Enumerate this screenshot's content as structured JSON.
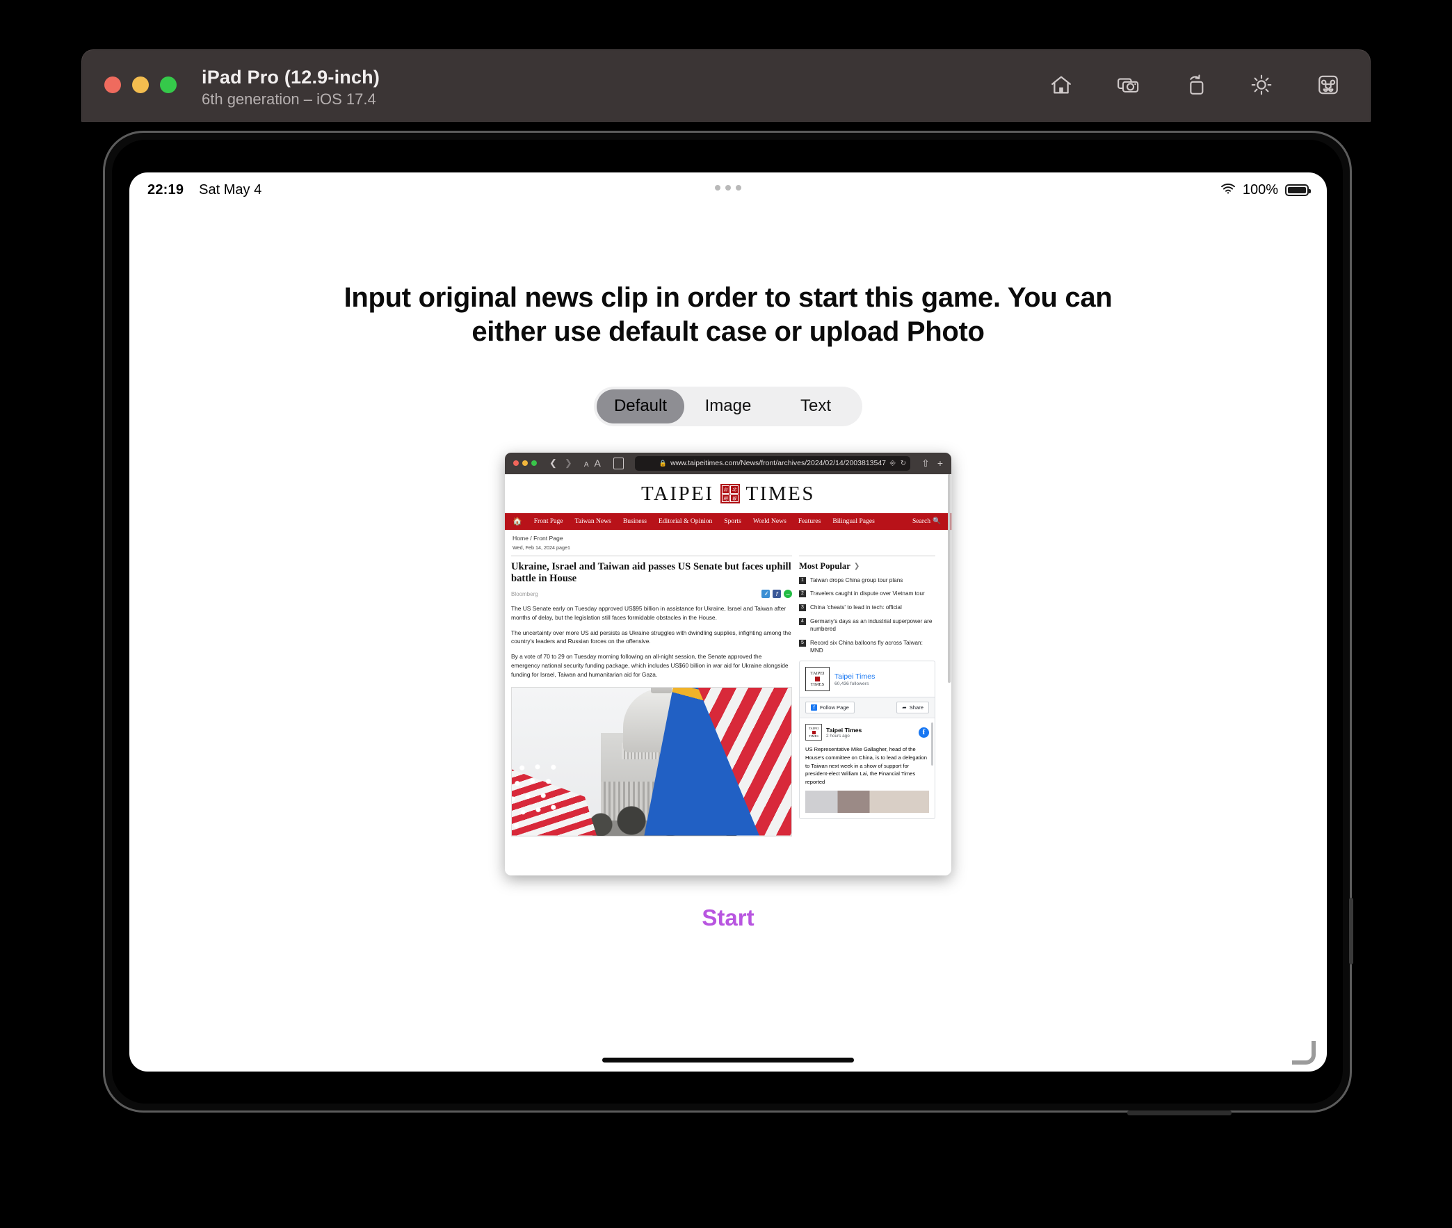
{
  "simulator": {
    "title": "iPad Pro (12.9-inch)",
    "subtitle": "6th generation – iOS 17.4",
    "toolbar": [
      {
        "name": "home-icon",
        "label": "Home"
      },
      {
        "name": "screenshot-icon",
        "label": "Screenshot"
      },
      {
        "name": "rotate-icon",
        "label": "Rotate"
      },
      {
        "name": "brightness-icon",
        "label": "Brightness"
      },
      {
        "name": "keyboard-icon",
        "label": "Keyboard"
      }
    ]
  },
  "statusbar": {
    "time": "22:19",
    "date": "Sat May 4",
    "battery_percent": "100%",
    "wifi_icon": "wifi-icon",
    "battery_icon": "battery-icon"
  },
  "app": {
    "headline": "Input original news clip in order to start this game. You can either use default case or upload Photo",
    "segmented": {
      "options": [
        "Default",
        "Image",
        "Text"
      ],
      "selected": "Default"
    },
    "start_label": "Start",
    "start_color": "#b855e0"
  },
  "screenshot": {
    "browser": {
      "url": "www.taipeitimes.com/News/front/archives/2024/02/14/2003813547",
      "lock_icon": "lock-icon",
      "back_icon": "chevron-left-icon",
      "forward_icon": "chevron-right-icon",
      "text_size_small": "A",
      "text_size_large": "A",
      "reader_icon": "reader-view-icon",
      "extension_icon": "extension-icon",
      "reload_icon": "reload-icon",
      "share_icon": "share-icon",
      "newtab_icon": "new-tab-icon"
    },
    "site": {
      "masthead_left": "TAIPEI",
      "masthead_right": "TIMES",
      "seal_chars": [
        "台",
        "北",
        "時",
        "報"
      ],
      "nav": [
        "Front Page",
        "Taiwan News",
        "Business",
        "Editorial & Opinion",
        "Sports",
        "World News",
        "Features",
        "Bilingual Pages"
      ],
      "search_label": "Search",
      "breadcrumb": "Home / Front Page",
      "dateline": "Wed, Feb 14, 2024 page1"
    },
    "article": {
      "headline": "Ukraine, Israel and Taiwan aid passes US Senate but faces uphill battle in House",
      "byline": "Bloomberg",
      "social": [
        "twitter-icon",
        "facebook-icon",
        "line-icon"
      ],
      "paragraphs": [
        "The US Senate early on Tuesday approved US$95 billion in assistance for Ukraine, Israel and Taiwan after months of delay, but the legislation still faces formidable obstacles in the House.",
        "The uncertainty over more US aid persists as Ukraine struggles with dwindling supplies, infighting among the country's leaders and Russian forces on the offensive.",
        "By a vote of 70 to 29 on Tuesday morning following an all-night session, the Senate approved the emergency national security funding package, which includes US$60 billion in war aid for Ukraine alongside funding for Israel, Taiwan and humanitarian aid for Gaza."
      ],
      "photo_caption": "US Capitol with American and Taiwanese flags"
    },
    "sidebar": {
      "most_popular_title": "Most Popular",
      "most_popular": [
        {
          "rank": "1",
          "text": "Taiwan drops China group tour plans"
        },
        {
          "rank": "2",
          "text": "Travelers caught in dispute over Vietnam tour"
        },
        {
          "rank": "3",
          "text": "China 'cheats' to lead in tech: official"
        },
        {
          "rank": "4",
          "text": "Germany's days as an industrial superpower are numbered"
        },
        {
          "rank": "5",
          "text": "Record six China balloons fly across Taiwan: MND"
        }
      ],
      "facebook": {
        "page_name": "Taipei Times",
        "followers": "60,436 followers",
        "logo_line1": "TAIPEI",
        "logo_line2": "TIMES",
        "follow_label": "Follow Page",
        "share_label": "Share",
        "post_author": "Taipei Times",
        "post_time": "2 hours ago",
        "post_text": "US Representative Mike Gallagher, head of the House's committee on China, is to lead a delegation to Taiwan next week in a show of support for president-elect William Lai, the Financial Times reported"
      }
    }
  }
}
